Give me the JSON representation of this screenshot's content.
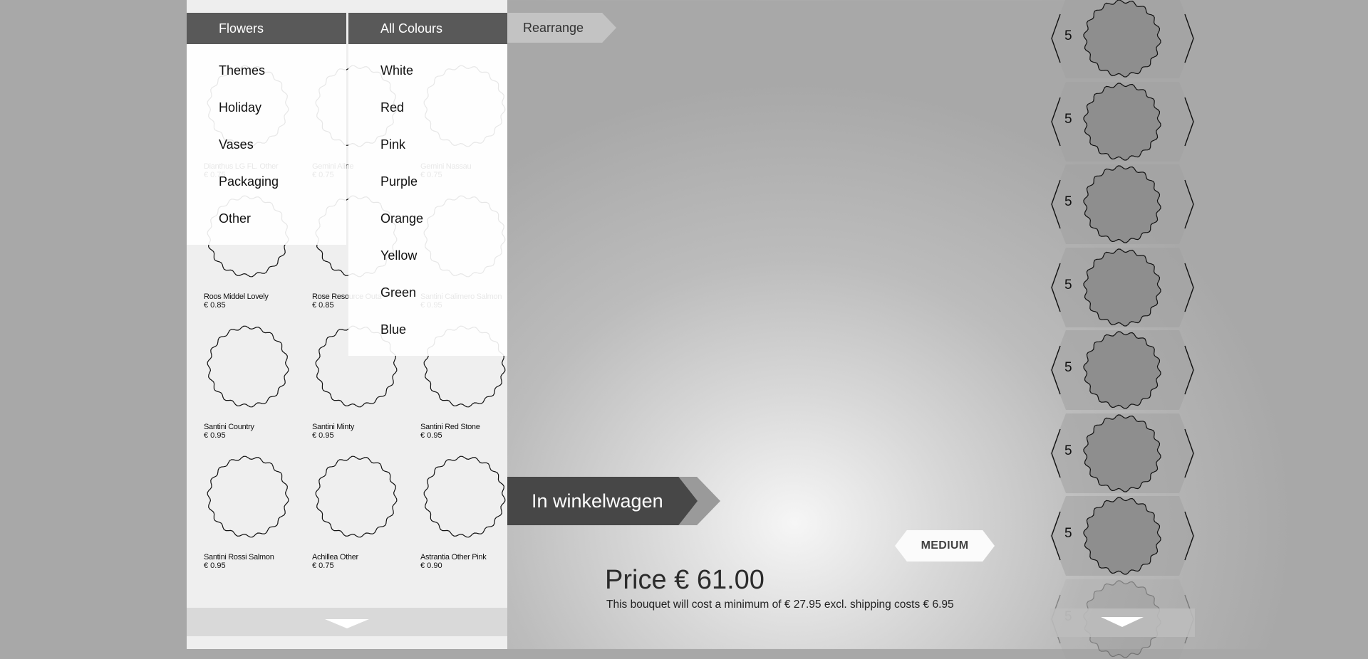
{
  "menus": {
    "category": {
      "label": "Flowers",
      "items": [
        "Themes",
        "Holiday",
        "Vases",
        "Packaging",
        "Other"
      ]
    },
    "colour": {
      "label": "All Colours",
      "items": [
        "White",
        "Red",
        "Pink",
        "Purple",
        "Orange",
        "Yellow",
        "Green",
        "Blue"
      ]
    },
    "rearrange_label": "Rearrange"
  },
  "products": [
    {
      "name": "Dianthus LG FL. Other",
      "price": "€ 0.75"
    },
    {
      "name": "Gemini Aline",
      "price": "€ 0.75"
    },
    {
      "name": "Gemini Nassau",
      "price": "€ 0.75"
    },
    {
      "name": "Roos Middel Lovely",
      "price": "€ 0.85"
    },
    {
      "name": "Rose Resource Outa",
      "price": "€ 0.85"
    },
    {
      "name": "Santini Calimero Salmon",
      "price": "€ 0.95"
    },
    {
      "name": "Santini Country",
      "price": "€ 0.95"
    },
    {
      "name": "Santini Minty",
      "price": "€ 0.95"
    },
    {
      "name": "Santini Red Stone",
      "price": "€ 0.95"
    },
    {
      "name": "Santini Rossi Salmon",
      "price": "€ 0.95"
    },
    {
      "name": "Achillea Other",
      "price": "€ 0.75"
    },
    {
      "name": "Astrantia Other Pink",
      "price": "€ 0.90"
    }
  ],
  "cart": {
    "label": "In winkelwagen"
  },
  "size": {
    "label": "MEDIUM"
  },
  "price": {
    "label": "Price € 61.00",
    "note": "This bouquet will cost a minimum of € 27.95 excl. shipping costs € 6.95"
  },
  "bouquet_slots": [
    {
      "count": "5"
    },
    {
      "count": "5"
    },
    {
      "count": "5"
    },
    {
      "count": "5"
    },
    {
      "count": "5"
    },
    {
      "count": "5"
    },
    {
      "count": "5"
    },
    {
      "count": "5"
    }
  ],
  "icons": {
    "panel_scroll": "chevron-down-icon",
    "slot_scroll": "chevron-down-icon"
  },
  "colors": {
    "menu_header": "#595959",
    "cart_button": "#474747",
    "panel_bg": "#efefef",
    "slot_fill": "#a0a0a0",
    "flower_fill": "#8e8e8e"
  }
}
